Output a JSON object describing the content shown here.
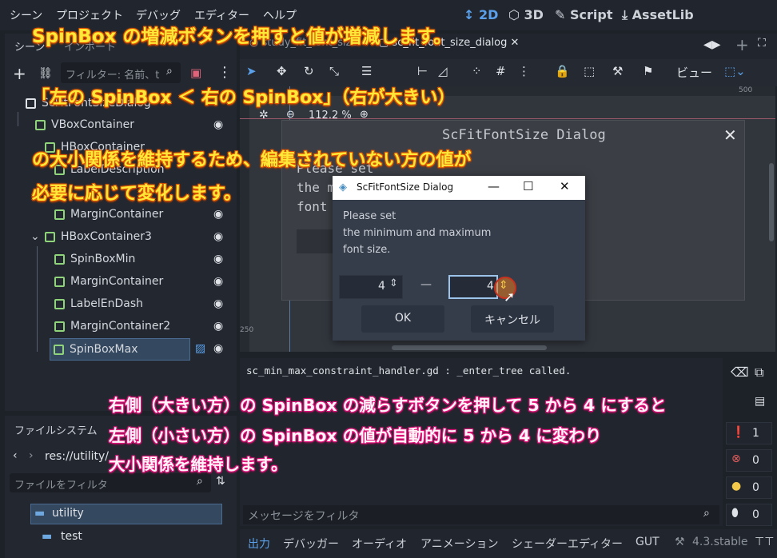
{
  "menubar": {
    "items": [
      "シーン",
      "プロジェクト",
      "デバッグ",
      "エディター",
      "ヘルプ"
    ],
    "modes": [
      "2D",
      "3D",
      "Script",
      "AssetLib"
    ]
  },
  "scene_panel": {
    "tabs": [
      "シーン",
      "インポート"
    ],
    "filter_placeholder": "フィルター: 名前、t",
    "tree": [
      {
        "label": "ScFitFontSizeDialog",
        "icon": "panel-icon"
      },
      {
        "label": "VBoxContainer",
        "icon": "vbox-icon"
      },
      {
        "label": "HBoxContainer",
        "icon": "hbox-icon"
      },
      {
        "label": "LabelDescription",
        "icon": "label-icon"
      },
      {
        "label": "MarginContainer",
        "icon": "margin-icon"
      },
      {
        "label": "HBoxContainer3",
        "icon": "hbox-icon"
      },
      {
        "label": "SpinBoxMin",
        "icon": "spinbox-icon"
      },
      {
        "label": "MarginContainer",
        "icon": "margin-icon"
      },
      {
        "label": "LabelEnDash",
        "icon": "label-icon"
      },
      {
        "label": "MarginContainer2",
        "icon": "margin-icon"
      },
      {
        "label": "SpinBoxMax",
        "icon": "spinbox-icon"
      }
    ]
  },
  "filesystem": {
    "title": "ファイルシステム",
    "path": "res://utility/",
    "filter_placeholder": "ファイルをフィルタ",
    "items": [
      "utility",
      "test"
    ]
  },
  "editor_tabs": [
    "study_fit_font_size",
    "sc_fit_font_size_dialog"
  ],
  "viewport": {
    "zoom": "112.2 %",
    "ruler_500": "500",
    "ruler_250": "250",
    "view_label": "ビュー"
  },
  "bg_dialog": {
    "title": "ScFitFontSize Dialog",
    "text_lines": [
      "Please set",
      "the m",
      "font"
    ]
  },
  "popup": {
    "title": "ScFitFontSize Dialog",
    "description": [
      "Please set",
      "the minimum and maximum",
      "font size."
    ],
    "min_value": "4",
    "dash": "—",
    "max_value": "4",
    "ok_label": "OK",
    "cancel_label": "キャンセル"
  },
  "output": {
    "log_line": "sc_min_max_constraint_handler.gd : _enter_tree called.",
    "filter_placeholder": "メッセージをフィルタ",
    "counts": [
      "1",
      "0",
      "0",
      "0"
    ]
  },
  "bottom_tabs": [
    "出力",
    "デバッガー",
    "オーディオ",
    "アニメーション",
    "シェーダーエディター",
    "GUT"
  ],
  "version": "4.3.stable",
  "annotations": {
    "line1": "SpinBox の増減ボタンを押すと値が増減します。",
    "line2": "「左の SpinBox ＜ 右の SpinBox」（右が大きい）",
    "line3": "の大小関係を維持するため、編集されていない方の値が",
    "line4": "必要に応じて変化します。",
    "line5": "右側（大きい方）の SpinBox の減らすボタンを押して 5 から 4 にすると",
    "line6": "左側（小さい方）の SpinBox の値が自動的に 5 から 4 に変わり",
    "line7": "大小関係を維持します。"
  }
}
